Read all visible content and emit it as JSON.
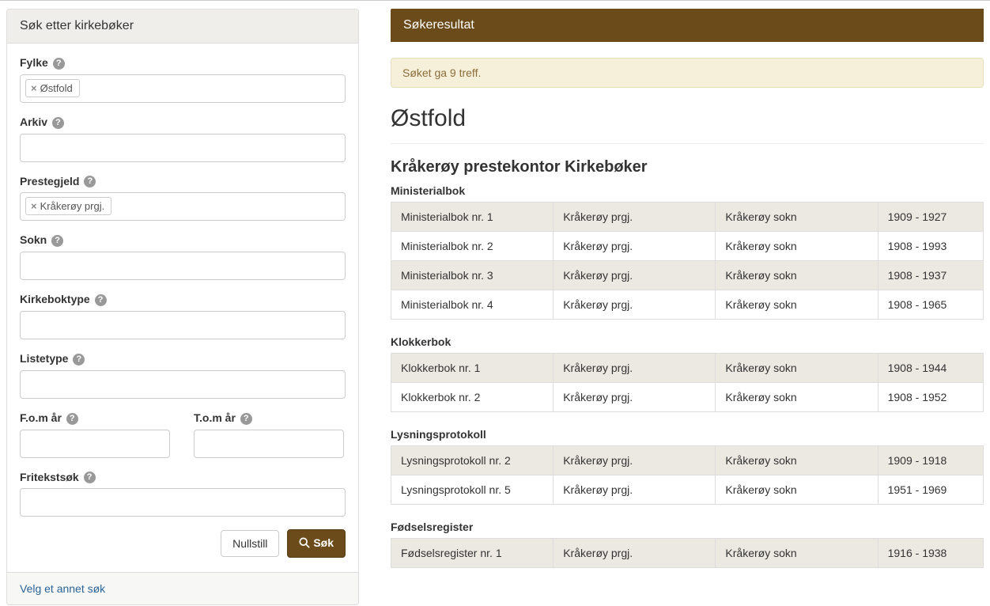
{
  "search_panel": {
    "title": "Søk etter kirkebøker",
    "fields": {
      "fylke": {
        "label": "Fylke",
        "tag": "Østfold"
      },
      "arkiv": {
        "label": "Arkiv"
      },
      "prestegjeld": {
        "label": "Prestegjeld",
        "tag": "Kråkerøy prgj."
      },
      "sokn": {
        "label": "Sokn"
      },
      "kirkeboktype": {
        "label": "Kirkeboktype"
      },
      "listetype": {
        "label": "Listetype"
      },
      "fom": {
        "label": "F.o.m år"
      },
      "tom": {
        "label": "T.o.m år"
      },
      "fritekst": {
        "label": "Fritekstsøk"
      }
    },
    "buttons": {
      "reset": "Nullstill",
      "search": "Søk"
    },
    "footer_link": "Velg et annet søk"
  },
  "results": {
    "heading": "Søkeresultat",
    "alert": "Søket ga 9 treff.",
    "region": "Østfold",
    "archive": "Kråkerøy prestekontor Kirkebøker",
    "sections": [
      {
        "title": "Ministerialbok",
        "rows": [
          {
            "name": "Ministerialbok nr. 1",
            "prgj": "Kråkerøy prgj.",
            "sokn": "Kråkerøy sokn",
            "years": "1909 - 1927"
          },
          {
            "name": "Ministerialbok nr. 2",
            "prgj": "Kråkerøy prgj.",
            "sokn": "Kråkerøy sokn",
            "years": "1908 - 1993"
          },
          {
            "name": "Ministerialbok nr. 3",
            "prgj": "Kråkerøy prgj.",
            "sokn": "Kråkerøy sokn",
            "years": "1908 - 1937"
          },
          {
            "name": "Ministerialbok nr. 4",
            "prgj": "Kråkerøy prgj.",
            "sokn": "Kråkerøy sokn",
            "years": "1908 - 1965"
          }
        ]
      },
      {
        "title": "Klokkerbok",
        "rows": [
          {
            "name": "Klokkerbok nr. 1",
            "prgj": "Kråkerøy prgj.",
            "sokn": "Kråkerøy sokn",
            "years": "1908 - 1944"
          },
          {
            "name": "Klokkerbok nr. 2",
            "prgj": "Kråkerøy prgj.",
            "sokn": "Kråkerøy sokn",
            "years": "1908 - 1952"
          }
        ]
      },
      {
        "title": "Lysningsprotokoll",
        "rows": [
          {
            "name": "Lysningsprotokoll nr. 2",
            "prgj": "Kråkerøy prgj.",
            "sokn": "Kråkerøy sokn",
            "years": "1909 - 1918"
          },
          {
            "name": "Lysningsprotokoll nr. 5",
            "prgj": "Kråkerøy prgj.",
            "sokn": "Kråkerøy sokn",
            "years": "1951 - 1969"
          }
        ]
      },
      {
        "title": "Fødselsregister",
        "rows": [
          {
            "name": "Fødselsregister nr. 1",
            "prgj": "Kråkerøy prgj.",
            "sokn": "Kråkerøy sokn",
            "years": "1916 - 1938"
          }
        ]
      }
    ]
  }
}
